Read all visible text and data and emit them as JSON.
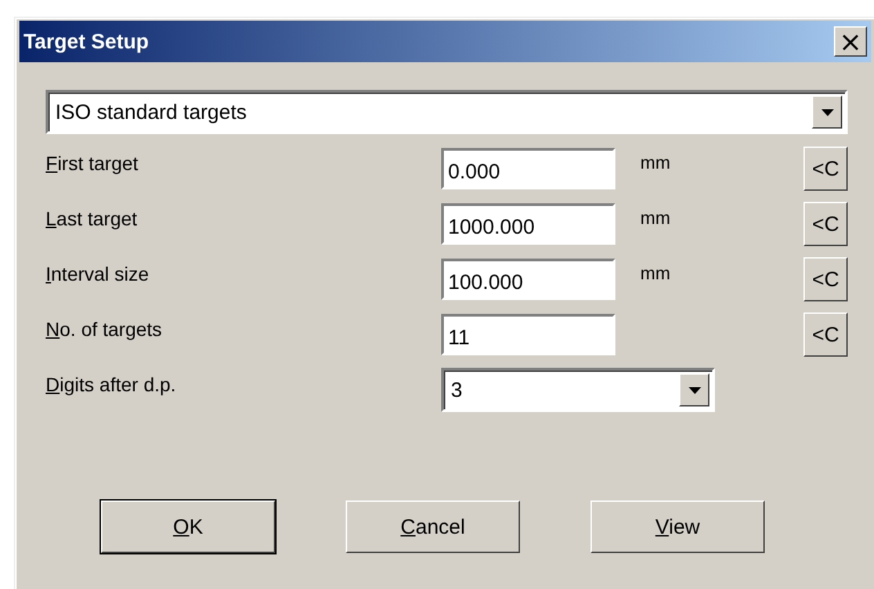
{
  "window": {
    "title": "Target Setup",
    "close_glyph": "×"
  },
  "preset": {
    "value": "ISO standard targets"
  },
  "fields": [
    {
      "kind": "text",
      "label": "First target",
      "underline_first": true,
      "value": "0.000",
      "unit": "mm",
      "reset": "<C"
    },
    {
      "kind": "text",
      "label": "Last target",
      "underline_first": true,
      "value": "1000.000",
      "unit": "mm",
      "reset": "<C"
    },
    {
      "kind": "text",
      "label": "Interval size",
      "underline_first": true,
      "value": "100.000",
      "unit": "mm",
      "reset": "<C"
    },
    {
      "kind": "text",
      "label": "No. of targets",
      "underline_first": true,
      "value": "11",
      "reset": "<C"
    },
    {
      "kind": "combo",
      "label": "Digits after d.p.",
      "underline_first": true,
      "value": "3"
    }
  ],
  "buttons": [
    {
      "label": "OK",
      "underline_first": true,
      "default": true
    },
    {
      "label": "Cancel",
      "underline_first": true,
      "default": false
    },
    {
      "label": "View",
      "underline_first": true,
      "default": false
    }
  ]
}
